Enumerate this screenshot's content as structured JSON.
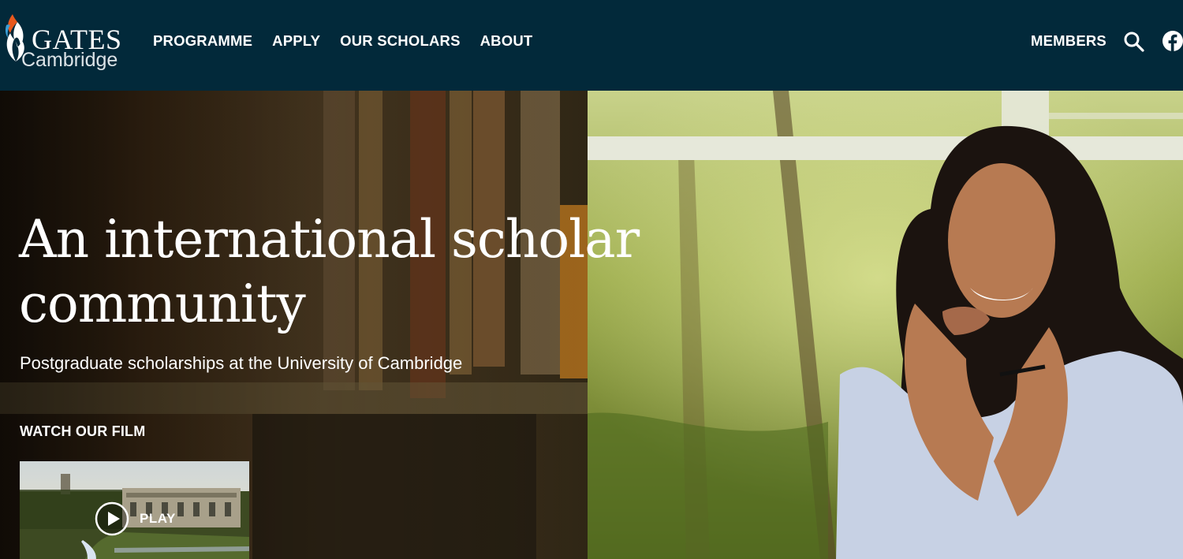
{
  "logo": {
    "line1": "GATES",
    "line2": "Cambridge"
  },
  "nav": {
    "items": [
      {
        "label": "PROGRAMME"
      },
      {
        "label": "APPLY"
      },
      {
        "label": "OUR SCHOLARS"
      },
      {
        "label": "ABOUT"
      }
    ],
    "members_label": "MEMBERS",
    "search_icon": "search-icon",
    "facebook_icon": "facebook-icon"
  },
  "hero": {
    "title": "An international scholar community",
    "subtitle": "Postgraduate scholarships at the University of Cambridge",
    "film_label": "WATCH OUR FILM",
    "play_label": "PLAY"
  },
  "colors": {
    "header_bg": "#02293a",
    "text": "#ffffff",
    "flame_orange": "#e8581d",
    "flame_blue": "#3aa0d8"
  }
}
